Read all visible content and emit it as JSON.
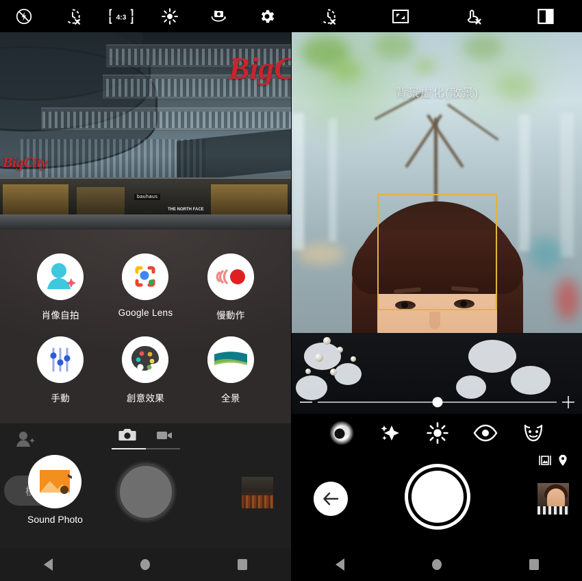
{
  "left_phone": {
    "topbar": [
      {
        "name": "flash-off-icon",
        "label": "flash-off"
      },
      {
        "name": "timer-off-icon",
        "label": "timer-off"
      },
      {
        "name": "aspect-ratio-icon",
        "label": "4:3"
      },
      {
        "name": "hdr-icon",
        "label": "hdr-auto"
      },
      {
        "name": "switch-camera-icon",
        "label": "switch-camera"
      },
      {
        "name": "settings-gear-icon",
        "label": "settings"
      }
    ],
    "aspect_ratio": "4:3",
    "viewfinder": {
      "scene": "shopping-mall-exterior",
      "signs": [
        "BigC",
        "BigCity",
        "bauhaus",
        "THE NORTH FACE"
      ]
    },
    "modes": [
      {
        "label": "肖像自拍",
        "icon": "portrait-selfie-icon"
      },
      {
        "label": "Google Lens",
        "icon": "google-lens-icon"
      },
      {
        "label": "慢動作",
        "icon": "slow-motion-icon"
      },
      {
        "label": "手動",
        "icon": "manual-icon"
      },
      {
        "label": "創意效果",
        "icon": "creative-effects-icon"
      },
      {
        "label": "全景",
        "icon": "panorama-icon"
      }
    ],
    "bottom": {
      "beauty_icon": "beauty-portrait-icon",
      "tabs": [
        {
          "label": "photo",
          "icon": "camera-icon",
          "active": true
        },
        {
          "label": "video",
          "icon": "video-icon",
          "active": false
        }
      ],
      "mode_button": "模式",
      "highlighted_mode": "Sound Photo",
      "shutter": "shutter-button",
      "thumbnail": "gallery-thumbnail"
    }
  },
  "right_phone": {
    "topbar": [
      {
        "name": "timer-off-icon",
        "label": "timer-off"
      },
      {
        "name": "aspect-ratio-full-icon",
        "label": "full-ratio"
      },
      {
        "name": "touch-capture-off-icon",
        "label": "touch-capture-off"
      },
      {
        "name": "split-screen-icon",
        "label": "split-view"
      }
    ],
    "viewfinder": {
      "title": "背景虛化(散景)",
      "face_detection_box": "face-detection-box",
      "face_box_color": "#e3b33c",
      "scene": "portrait-woman-bokeh"
    },
    "slider": {
      "minus_label": "-",
      "plus_label": "+",
      "value": 50
    },
    "effects": [
      {
        "name": "bokeh-effect-icon",
        "label": "bokeh",
        "active": true
      },
      {
        "name": "sparkle-effect-icon",
        "label": "sparkle",
        "active": false
      },
      {
        "name": "brightness-effect-icon",
        "label": "brightness",
        "active": false
      },
      {
        "name": "eye-enlarge-effect-icon",
        "label": "eye-enlarge",
        "active": false
      },
      {
        "name": "face-slim-effect-icon",
        "label": "face-slim",
        "active": false
      }
    ],
    "bottom": {
      "back_button": "back-arrow-button",
      "shutter": "shutter-button",
      "thumbnail": "gallery-thumbnail",
      "indicators": [
        {
          "name": "photo-size-icon",
          "label": "photo-size"
        },
        {
          "name": "location-pin-icon",
          "label": "geotag"
        }
      ]
    }
  },
  "navbar": {
    "back": "back-nav-button",
    "home": "home-nav-button",
    "recents": "recents-nav-button"
  },
  "colors": {
    "face_box": "#e3b33c",
    "mode_sheet_bg": "#302b2b",
    "accent_white": "#ffffff"
  }
}
